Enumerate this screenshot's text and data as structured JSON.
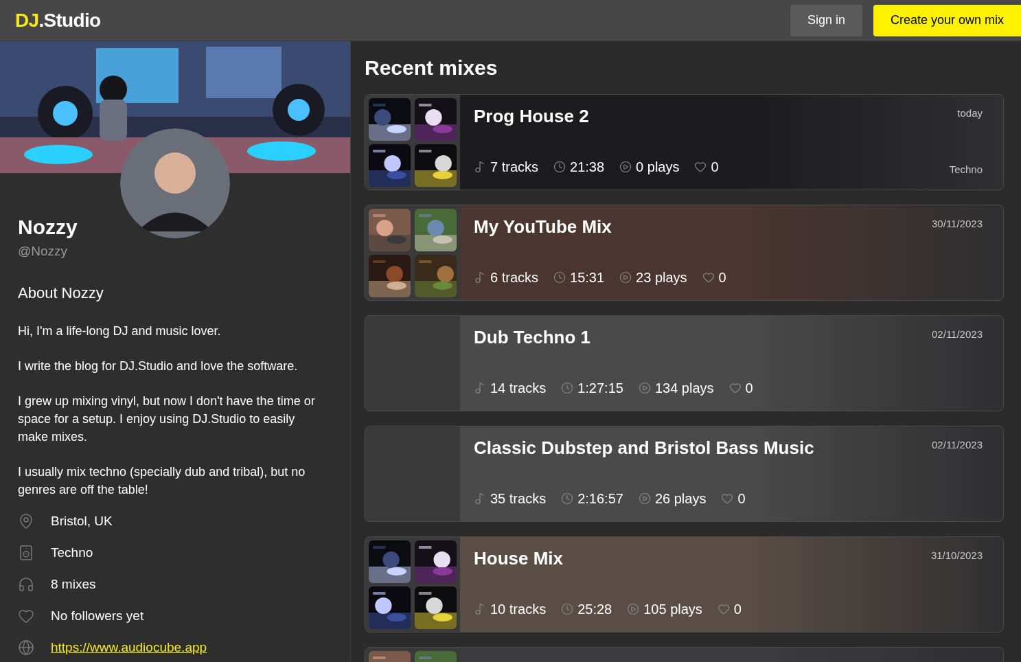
{
  "header": {
    "logo_mark": "DJ",
    "logo_text": ".Studio",
    "sign_in": "Sign in",
    "create": "Create your own mix"
  },
  "profile": {
    "name": "Nozzy",
    "handle": "@Nozzy",
    "about_title": "About Nozzy",
    "bio": [
      "Hi, I'm a life-long DJ and music lover.",
      "I write the blog for DJ.Studio and love the software.",
      "I grew up mixing vinyl, but now I don't have the time or space for a setup. I enjoy using DJ.Studio to easily make mixes.",
      "I usually mix techno (specially dub and tribal), but no genres are off the table!"
    ],
    "facts": [
      {
        "kind": "location",
        "text": "Bristol, UK"
      },
      {
        "kind": "genre",
        "text": "Techno"
      },
      {
        "kind": "mixes",
        "text": "8 mixes"
      },
      {
        "kind": "followers",
        "text": "No followers yet"
      },
      {
        "kind": "link",
        "text": "https://www.audiocube.app"
      }
    ]
  },
  "mixes_title": "Recent mixes",
  "mixes": [
    {
      "title": "Prog House 2",
      "date": "today",
      "genre": "Techno",
      "tracks": "7 tracks",
      "duration": "21:38",
      "plays": "0 plays",
      "likes": "0",
      "artwork": true,
      "color": "#1c1c1f"
    },
    {
      "title": "My YouTube Mix",
      "date": "30/11/2023",
      "tracks": "6 tracks",
      "duration": "15:31",
      "plays": "23 plays",
      "likes": "0",
      "artwork": true,
      "color": "#4a3530"
    },
    {
      "title": "Dub Techno 1",
      "date": "02/11/2023",
      "tracks": "14 tracks",
      "duration": "1:27:15",
      "plays": "134 plays",
      "likes": "0",
      "artwork": false,
      "color": "#4a4a4a"
    },
    {
      "title": "Classic Dubstep and Bristol Bass Music",
      "date": "02/11/2023",
      "tracks": "35 tracks",
      "duration": "2:16:57",
      "plays": "26 plays",
      "likes": "0",
      "artwork": false,
      "color": "#4a4a4a"
    },
    {
      "title": "House Mix",
      "date": "31/10/2023",
      "tracks": "10 tracks",
      "duration": "25:28",
      "plays": "105 plays",
      "likes": "0",
      "artwork": true,
      "color": "#5a4d45"
    },
    {
      "artwork": true,
      "color": "#3c3c3e"
    }
  ]
}
